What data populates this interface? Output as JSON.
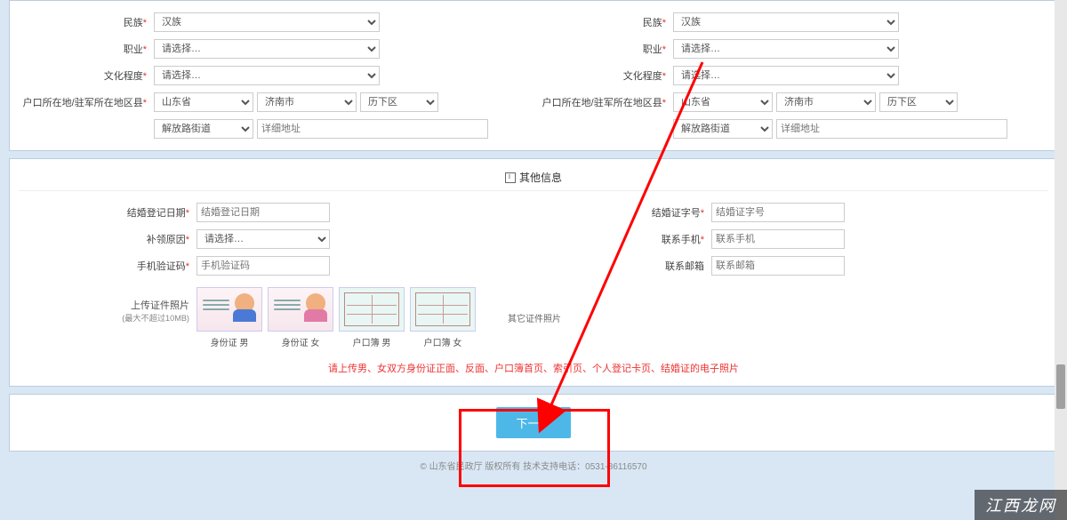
{
  "left": {
    "ethnicity_label": "民族",
    "ethnicity_value": "汉族",
    "occupation_label": "职业",
    "occupation_value": "请选择…",
    "education_label": "文化程度",
    "education_value": "请选择…",
    "region_label": "户口所在地/驻军所在地区县",
    "province": "山东省",
    "city": "济南市",
    "district": "历下区",
    "street": "解放路街道",
    "detail_placeholder": "详细地址"
  },
  "right": {
    "ethnicity_label": "民族",
    "ethnicity_value": "汉族",
    "occupation_label": "职业",
    "occupation_value": "请选择…",
    "education_label": "文化程度",
    "education_value": "请选择…",
    "region_label": "户口所在地/驻军所在地区县",
    "province": "山东省",
    "city": "济南市",
    "district": "历下区",
    "street": "解放路街道",
    "detail_placeholder": "详细地址"
  },
  "other": {
    "section_title": "其他信息",
    "reg_date_label": "结婚登记日期",
    "reg_date_placeholder": "结婚登记日期",
    "cert_no_label": "结婚证字号",
    "cert_no_placeholder": "结婚证字号",
    "reason_label": "补领原因",
    "reason_value": "请选择…",
    "phone_label": "联系手机",
    "phone_placeholder": "联系手机",
    "captcha_label": "手机验证码",
    "captcha_placeholder": "手机验证码",
    "email_label": "联系邮箱",
    "email_placeholder": "联系邮箱",
    "upload_label": "上传证件照片",
    "upload_limit": "(最大不超过10MB)",
    "thumbs": {
      "id_m": "身份证 男",
      "id_f": "身份证 女",
      "hukou_m": "户口簿 男",
      "hukou_f": "户口簿 女",
      "other": "其它证件照片"
    },
    "note": "请上传男、女双方身份证正面、反面、户口簿首页、索引页、个人登记卡页、结婚证的电子照片"
  },
  "next_button": "下一步",
  "footer": "© 山东省民政厅 版权所有   技术支持电话：0531-86116570",
  "watermark": "江西龙网"
}
